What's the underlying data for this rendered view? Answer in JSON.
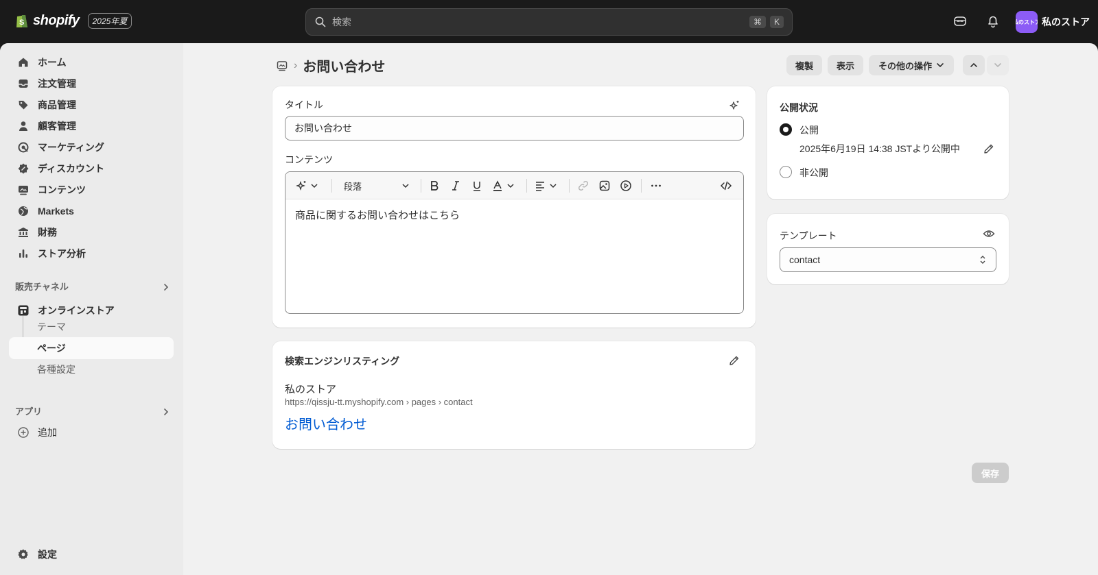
{
  "topbar": {
    "brand": "shopify",
    "edition_badge": "2025年夏",
    "search_placeholder": "検索",
    "shortcut_cmd": "⌘",
    "shortcut_key": "K",
    "avatar_text": "私のストア",
    "store_name": "私のストア"
  },
  "sidebar": {
    "items": [
      {
        "label": "ホーム",
        "icon": "home-icon"
      },
      {
        "label": "注文管理",
        "icon": "inbox-icon"
      },
      {
        "label": "商品管理",
        "icon": "tag-icon"
      },
      {
        "label": "顧客管理",
        "icon": "person-icon"
      },
      {
        "label": "マーケティング",
        "icon": "target-icon"
      },
      {
        "label": "ディスカウント",
        "icon": "discount-icon"
      },
      {
        "label": "コンテンツ",
        "icon": "content-icon"
      },
      {
        "label": "Markets",
        "icon": "globe-icon"
      },
      {
        "label": "財務",
        "icon": "bank-icon"
      },
      {
        "label": "ストア分析",
        "icon": "chart-icon"
      }
    ],
    "sales_channels_title": "販売チャネル",
    "online_store_label": "オンラインストア",
    "sub_items": [
      "テーマ",
      "ページ",
      "各種設定"
    ],
    "apps_title": "アプリ",
    "add_label": "追加",
    "settings_label": "設定"
  },
  "page": {
    "title": "お問い合わせ",
    "actions": {
      "duplicate": "複製",
      "view": "表示",
      "more": "その他の操作"
    }
  },
  "content_card": {
    "title_label": "タイトル",
    "title_value": "お問い合わせ",
    "content_label": "コンテンツ",
    "paragraph_select": "段落",
    "body_text": "商品に関するお問い合わせはこちら"
  },
  "seo_card": {
    "title": "検索エンジンリスティング",
    "store_name": "私のストア",
    "url": "https://qissju-tt.myshopify.com › pages › contact",
    "page_title": "お問い合わせ"
  },
  "visibility_card": {
    "title": "公開状況",
    "published_label": "公開",
    "published_detail": "2025年6月19日 14:38 JSTより公開中",
    "hidden_label": "非公開",
    "selected": "公開"
  },
  "template_card": {
    "label": "テンプレート",
    "value": "contact"
  },
  "save_label": "保存",
  "colors": {
    "topbar": "#1a1a1a",
    "background": "#f1f1f1",
    "link": "#005bd3",
    "avatar": "#8c5cf6"
  }
}
